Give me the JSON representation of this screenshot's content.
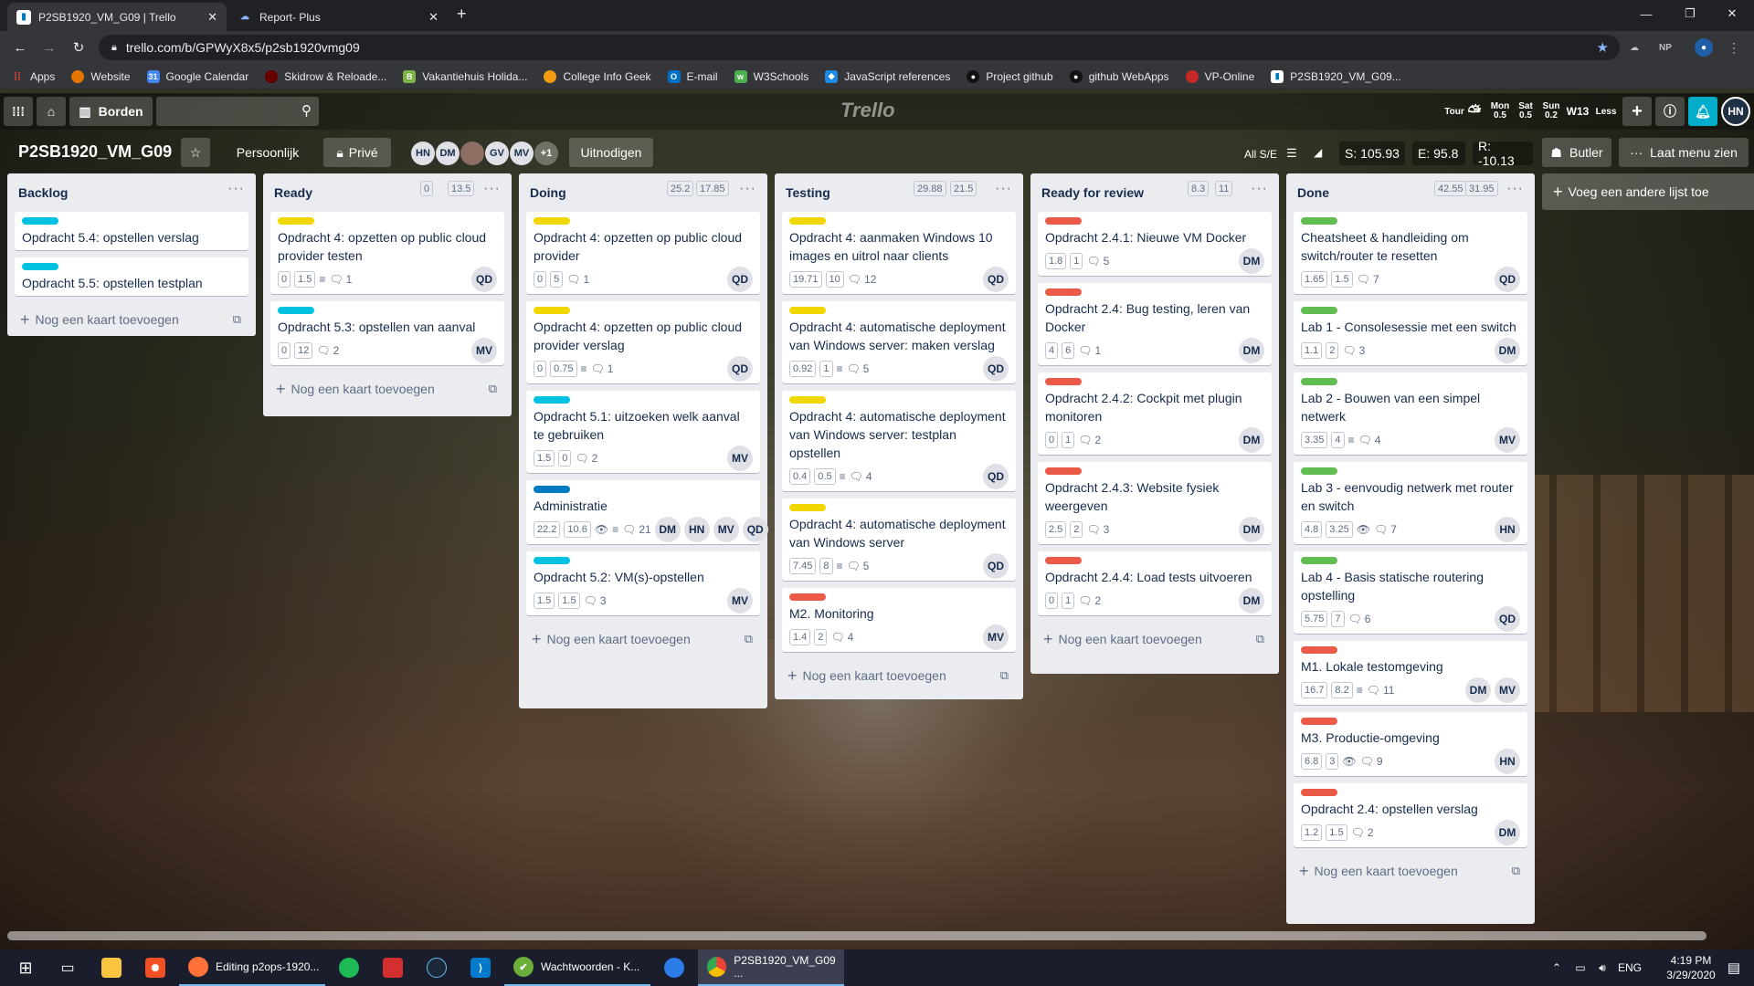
{
  "browser": {
    "tabs": [
      {
        "title": "P2SB1920_VM_G09 | Trello",
        "active": true
      },
      {
        "title": "Report- Plus",
        "active": false
      }
    ],
    "new_tab": "+",
    "url": "trello.com/b/GPWyX8x5/p2sb1920vmg09",
    "ext_np": "NP",
    "bookmarks": [
      "Apps",
      "Website",
      "Google Calendar",
      "Skidrow & Reloade...",
      "Vakantiehuis Holida...",
      "College Info Geek",
      "E-mail",
      "W3Schools",
      "JavaScript references",
      "Project github",
      "github WebApps",
      "VP-Online",
      "P2SB1920_VM_G09..."
    ]
  },
  "trello_header": {
    "boards_label": "Borden",
    "logo": "Trello",
    "weather": [
      {
        "label": "Tour"
      },
      {
        "label": "Mon",
        "value": "0.5"
      },
      {
        "label": "Sat",
        "value": "0.5"
      },
      {
        "label": "Sun",
        "value": "0.2"
      }
    ],
    "week": "W13",
    "less": "Less",
    "user": "HN"
  },
  "board": {
    "title": "P2SB1920_VM_G09",
    "team": "Persoonlijk",
    "visibility": "Privé",
    "members": [
      "HN",
      "DM",
      "",
      "GV",
      "MV"
    ],
    "more_members": "+1",
    "invite": "Uitnodigen",
    "filter": "All S/E",
    "stats": {
      "s": "S: 105.93",
      "e": "E: 95.8",
      "r": "R: -10.13"
    },
    "butler": "Butler",
    "menu": "Laat menu zien",
    "add_list": "Voeg een andere lijst toe",
    "add_card": "Nog een kaart toevoegen"
  },
  "colors": {
    "cyan": "#00c2e0",
    "yellow": "#f2d600",
    "red": "#eb5a46",
    "green": "#61bd4f",
    "blue": "#0079bf"
  },
  "lists": [
    {
      "name": "Backlog",
      "badges": [],
      "cards": [
        {
          "label": "cyan",
          "title": "Opdracht 5.4: opstellen verslag",
          "badges": [],
          "members": []
        },
        {
          "label": "cyan",
          "title": "Opdracht 5.5: opstellen testplan",
          "badges": [],
          "members": []
        }
      ]
    },
    {
      "name": "Ready",
      "badges": [
        "0",
        "13.5"
      ],
      "cards": [
        {
          "label": "yellow",
          "title": "Opdracht 4: opzetten op public cloud provider testen",
          "badges": [
            "0",
            "1.5"
          ],
          "desc": true,
          "watch": false,
          "comments": "1",
          "members": [
            "QD"
          ]
        },
        {
          "label": "cyan",
          "title": "Opdracht 5.3: opstellen van aanval",
          "badges": [
            "0",
            "12"
          ],
          "desc": false,
          "watch": false,
          "comments": "2",
          "members": [
            "MV"
          ]
        }
      ]
    },
    {
      "name": "Doing",
      "badges": [
        "25.2",
        "17.85"
      ],
      "cards": [
        {
          "label": "yellow",
          "title": "Opdracht 4: opzetten op public cloud provider",
          "badges": [
            "0",
            "5"
          ],
          "desc": false,
          "watch": false,
          "comments": "1",
          "members": [
            "QD"
          ]
        },
        {
          "label": "yellow",
          "title": "Opdracht 4: opzetten op public cloud provider verslag",
          "badges": [
            "0",
            "0.75"
          ],
          "desc": true,
          "watch": false,
          "comments": "1",
          "members": [
            "QD"
          ]
        },
        {
          "label": "cyan",
          "title": "Opdracht 5.1: uitzoeken welk aanval te gebruiken",
          "badges": [
            "1.5",
            "0"
          ],
          "desc": false,
          "watch": false,
          "comments": "2",
          "members": [
            "MV"
          ]
        },
        {
          "label": "blue",
          "title": "Administratie",
          "badges": [
            "22.2",
            "10.6"
          ],
          "desc": true,
          "watch": true,
          "comments": "21",
          "members": [
            "DM",
            "HN",
            "MV",
            "QD"
          ]
        },
        {
          "label": "cyan",
          "title": "Opdracht 5.2: VM(s)-opstellen",
          "badges": [
            "1.5",
            "1.5"
          ],
          "desc": false,
          "watch": false,
          "comments": "3",
          "members": [
            "MV"
          ]
        }
      ]
    },
    {
      "name": "Testing",
      "badges": [
        "29.88",
        "21.5"
      ],
      "cards": [
        {
          "label": "yellow",
          "title": "Opdracht 4: aanmaken Windows 10 images en uitrol naar clients",
          "badges": [
            "19.71",
            "10"
          ],
          "desc": false,
          "watch": false,
          "comments": "12",
          "members": [
            "QD"
          ]
        },
        {
          "label": "yellow",
          "title": "Opdracht 4: automatische deployment van Windows server: maken verslag",
          "badges": [
            "0.92",
            "1"
          ],
          "desc": true,
          "watch": false,
          "comments": "5",
          "members": [
            "QD"
          ]
        },
        {
          "label": "yellow",
          "title": "Opdracht 4: automatische deployment van Windows server: testplan opstellen",
          "badges": [
            "0.4",
            "0.5"
          ],
          "desc": true,
          "watch": false,
          "comments": "4",
          "members": [
            "QD"
          ]
        },
        {
          "label": "yellow",
          "title": "Opdracht 4: automatische deployment van Windows server",
          "badges": [
            "7.45",
            "8"
          ],
          "desc": true,
          "watch": false,
          "comments": "5",
          "members": [
            "QD"
          ]
        },
        {
          "label": "red",
          "title": "M2. Monitoring",
          "badges": [
            "1.4",
            "2"
          ],
          "desc": false,
          "watch": false,
          "comments": "4",
          "members": [
            "MV"
          ]
        }
      ]
    },
    {
      "name": "Ready for review",
      "badges": [
        "8.3",
        "11"
      ],
      "cards": [
        {
          "label": "red",
          "title": "Opdracht 2.4.1: Nieuwe VM Docker",
          "badges": [
            "1.8",
            "1"
          ],
          "desc": false,
          "watch": false,
          "comments": "5",
          "members": [
            "DM"
          ]
        },
        {
          "label": "red",
          "title": "Opdracht 2.4: Bug testing, leren van Docker",
          "badges": [
            "4",
            "6"
          ],
          "desc": false,
          "watch": false,
          "comments": "1",
          "members": [
            "DM"
          ]
        },
        {
          "label": "red",
          "title": "Opdracht 2.4.2: Cockpit met plugin monitoren",
          "badges": [
            "0",
            "1"
          ],
          "desc": false,
          "watch": false,
          "comments": "2",
          "members": [
            "DM"
          ]
        },
        {
          "label": "red",
          "title": "Opdracht 2.4.3: Website fysiek weergeven",
          "badges": [
            "2.5",
            "2"
          ],
          "desc": false,
          "watch": false,
          "comments": "3",
          "members": [
            "DM"
          ]
        },
        {
          "label": "red",
          "title": "Opdracht 2.4.4: Load tests uitvoeren",
          "badges": [
            "0",
            "1"
          ],
          "desc": false,
          "watch": false,
          "comments": "2",
          "members": [
            "DM"
          ]
        }
      ]
    },
    {
      "name": "Done",
      "badges": [
        "42.55",
        "31.95"
      ],
      "cards": [
        {
          "label": "green",
          "title": "Cheatsheet & handleiding om switch/router te resetten",
          "badges": [
            "1.65",
            "1.5"
          ],
          "desc": false,
          "watch": false,
          "comments": "7",
          "members": [
            "QD"
          ]
        },
        {
          "label": "green",
          "title": "Lab 1 - Consolesessie met een switch",
          "badges": [
            "1.1",
            "2"
          ],
          "desc": false,
          "watch": false,
          "comments": "3",
          "members": [
            "DM"
          ]
        },
        {
          "label": "green",
          "title": "Lab 2 - Bouwen van een simpel netwerk",
          "badges": [
            "3.35",
            "4"
          ],
          "desc": true,
          "watch": false,
          "comments": "4",
          "members": [
            "MV"
          ]
        },
        {
          "label": "green",
          "title": "Lab 3 - eenvoudig netwerk met router en switch",
          "badges": [
            "4.8",
            "3.25"
          ],
          "desc": false,
          "watch": true,
          "comments": "7",
          "members": [
            "HN"
          ]
        },
        {
          "label": "green",
          "title": "Lab 4 - Basis statische routering opstelling",
          "badges": [
            "5.75",
            "7"
          ],
          "desc": false,
          "watch": false,
          "comments": "6",
          "members": [
            "QD"
          ]
        },
        {
          "label": "red",
          "title": "M1. Lokale testomgeving",
          "badges": [
            "16.7",
            "8.2"
          ],
          "desc": true,
          "watch": false,
          "comments": "11",
          "members": [
            "DM",
            "MV"
          ]
        },
        {
          "label": "red",
          "title": "M3. Productie-omgeving",
          "badges": [
            "6.8",
            "3"
          ],
          "desc": false,
          "watch": true,
          "comments": "9",
          "members": [
            "HN"
          ]
        },
        {
          "label": "red",
          "title": "Opdracht 2.4: opstellen verslag",
          "badges": [
            "1.2",
            "1.5"
          ],
          "desc": false,
          "watch": false,
          "comments": "2",
          "members": [
            "DM"
          ]
        }
      ]
    }
  ],
  "taskbar": {
    "apps": [
      {
        "icon": "firefox",
        "label": "Editing p2ops-1920..."
      },
      {
        "icon": "keepass",
        "label": "Wachtwoorden - K..."
      },
      {
        "icon": "chrome",
        "label": "P2SB1920_VM_G09 ..."
      }
    ],
    "lang": "ENG",
    "time": "4:19 PM",
    "date": "3/29/2020"
  }
}
